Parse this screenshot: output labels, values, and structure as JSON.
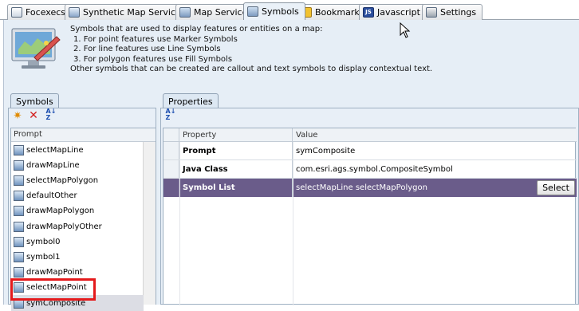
{
  "tabs": [
    {
      "label": "Focexecs",
      "icon": "focexec-icon"
    },
    {
      "label": "Synthetic Map Services",
      "icon": "synthetic-map-icon"
    },
    {
      "label": "Map Services",
      "icon": "map-services-icon"
    },
    {
      "label": "Symbols",
      "icon": "symbols-icon",
      "active": true
    },
    {
      "label": "Bookmarks",
      "icon": "bookmark-icon"
    },
    {
      "label": "Javascript",
      "icon": "javascript-icon"
    },
    {
      "label": "Settings",
      "icon": "settings-icon"
    }
  ],
  "info": {
    "line1": "Symbols that are used to display features or entities on a map:",
    "line2": "1. For point features use Marker Symbols",
    "line3": "2. For line features use Line Symbols",
    "line4": "3. For polygon features use Fill Symbols",
    "line5": "Other symbols that can be created are callout and text symbols to display contextual text."
  },
  "symbols_panel": {
    "tab_label": "Symbols",
    "column_header": "Prompt",
    "items": [
      "selectMapLine",
      "drawMapLine",
      "selectMapPolygon",
      "defaultOther",
      "drawMapPolygon",
      "drawMapPolyOther",
      "symbol0",
      "symbol1",
      "drawMapPoint",
      "selectMapPoint",
      "symComposite"
    ],
    "selected": "symComposite"
  },
  "properties_panel": {
    "tab_label": "Properties",
    "headers": {
      "property": "Property",
      "value": "Value"
    },
    "rows": [
      {
        "property": "Prompt",
        "value": "symComposite"
      },
      {
        "property": "Java Class",
        "value": "com.esri.ags.symbol.CompositeSymbol"
      },
      {
        "property": "Symbol List",
        "value": "selectMapLine selectMapPolygon",
        "selected": true,
        "button": "Select"
      }
    ]
  },
  "colors": {
    "selected_row": "#6a5c8a",
    "highlight_box": "#e41a1c",
    "panel_bg": "#e6eef6"
  }
}
